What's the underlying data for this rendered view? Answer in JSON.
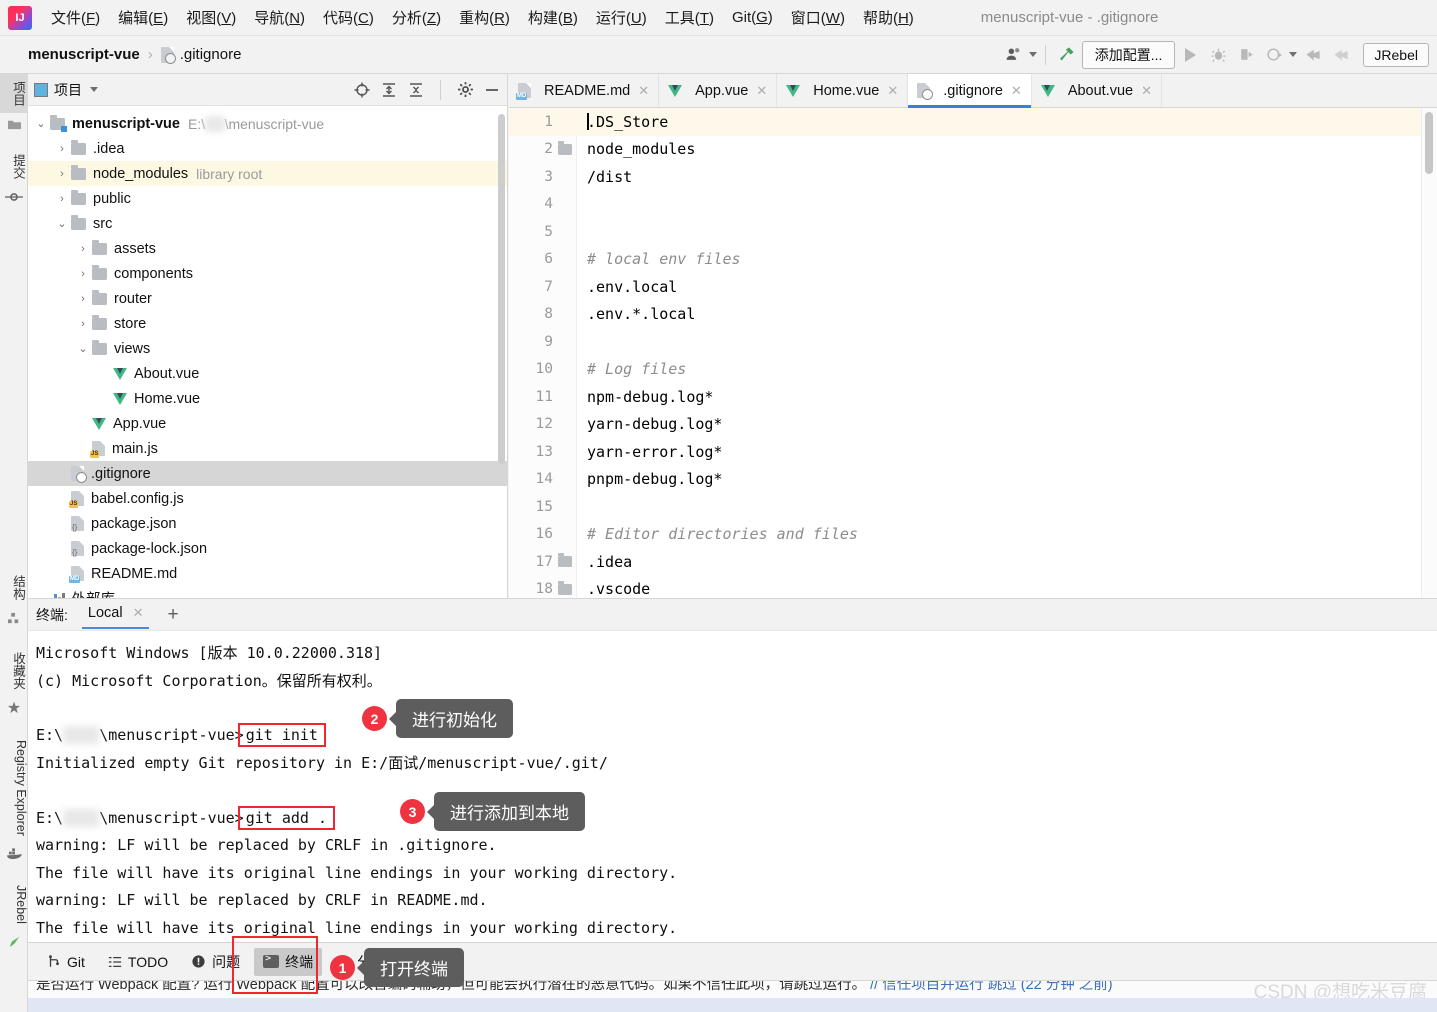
{
  "window": {
    "title": "menuscript-vue - .gitignore"
  },
  "menubar": [
    {
      "label": "文件",
      "mnemonic": "F"
    },
    {
      "label": "编辑",
      "mnemonic": "E"
    },
    {
      "label": "视图",
      "mnemonic": "V"
    },
    {
      "label": "导航",
      "mnemonic": "N"
    },
    {
      "label": "代码",
      "mnemonic": "C"
    },
    {
      "label": "分析",
      "mnemonic": "Z"
    },
    {
      "label": "重构",
      "mnemonic": "R"
    },
    {
      "label": "构建",
      "mnemonic": "B"
    },
    {
      "label": "运行",
      "mnemonic": "U"
    },
    {
      "label": "工具",
      "mnemonic": "T"
    },
    {
      "label": "Git",
      "mnemonic": "G"
    },
    {
      "label": "窗口",
      "mnemonic": "W"
    },
    {
      "label": "帮助",
      "mnemonic": "H"
    }
  ],
  "navbar": {
    "breadcrumb_project": "menuscript-vue",
    "breadcrumb_sep": "›",
    "breadcrumb_file": ".gitignore",
    "add_config_label": "添加配置...",
    "jrebel_label": "JRebel"
  },
  "left_strip": [
    {
      "label": "项目",
      "icon": "project-icon",
      "active": true
    },
    {
      "label": "提交",
      "icon": "commit-icon",
      "active": false
    },
    {
      "label": "结构",
      "icon": "structure-icon",
      "active": false
    },
    {
      "label": "收藏夹",
      "icon": "star-icon",
      "active": false
    },
    {
      "label": "Registry Explorer",
      "icon": "docker-icon",
      "active": false
    },
    {
      "label": "JRebel",
      "icon": "jrebel-icon",
      "active": false
    }
  ],
  "project_panel": {
    "title": "项目",
    "tree": [
      {
        "depth": 0,
        "arrow": "⌄",
        "icon": "folder-module",
        "label": "menuscript-vue",
        "bold": true,
        "dim": "E:\\",
        "dim_blur": true,
        "dim_tail": "\\menuscript-vue",
        "state": "normal"
      },
      {
        "depth": 1,
        "arrow": "›",
        "icon": "folder",
        "label": ".idea",
        "state": "normal"
      },
      {
        "depth": 1,
        "arrow": "›",
        "icon": "folder",
        "label": "node_modules",
        "dim": "library root",
        "state": "highlight"
      },
      {
        "depth": 1,
        "arrow": "›",
        "icon": "folder",
        "label": "public",
        "state": "normal"
      },
      {
        "depth": 1,
        "arrow": "⌄",
        "icon": "folder",
        "label": "src",
        "state": "normal"
      },
      {
        "depth": 2,
        "arrow": "›",
        "icon": "folder",
        "label": "assets",
        "state": "normal"
      },
      {
        "depth": 2,
        "arrow": "›",
        "icon": "folder",
        "label": "components",
        "state": "normal"
      },
      {
        "depth": 2,
        "arrow": "›",
        "icon": "folder",
        "label": "router",
        "state": "normal"
      },
      {
        "depth": 2,
        "arrow": "›",
        "icon": "folder",
        "label": "store",
        "state": "normal"
      },
      {
        "depth": 2,
        "arrow": "⌄",
        "icon": "folder",
        "label": "views",
        "state": "normal"
      },
      {
        "depth": 3,
        "arrow": "",
        "icon": "vue",
        "label": "About.vue",
        "state": "normal"
      },
      {
        "depth": 3,
        "arrow": "",
        "icon": "vue",
        "label": "Home.vue",
        "state": "normal"
      },
      {
        "depth": 2,
        "arrow": "",
        "icon": "vue",
        "label": "App.vue",
        "state": "normal"
      },
      {
        "depth": 2,
        "arrow": "",
        "icon": "js",
        "label": "main.js",
        "state": "normal"
      },
      {
        "depth": 1,
        "arrow": "",
        "icon": "gitignore",
        "label": ".gitignore",
        "state": "selected"
      },
      {
        "depth": 1,
        "arrow": "",
        "icon": "js",
        "label": "babel.config.js",
        "state": "normal"
      },
      {
        "depth": 1,
        "arrow": "",
        "icon": "json",
        "label": "package.json",
        "state": "normal"
      },
      {
        "depth": 1,
        "arrow": "",
        "icon": "json",
        "label": "package-lock.json",
        "state": "normal"
      },
      {
        "depth": 1,
        "arrow": "",
        "icon": "md",
        "label": "README.md",
        "state": "normal"
      }
    ],
    "external_libraries": "外部库"
  },
  "editor": {
    "tabs": [
      {
        "label": "README.md",
        "icon": "md-file-icon",
        "active": false
      },
      {
        "label": "App.vue",
        "icon": "vue-file-icon",
        "active": false
      },
      {
        "label": "Home.vue",
        "icon": "vue-file-icon",
        "active": false
      },
      {
        "label": ".gitignore",
        "icon": "gitignore-file-icon",
        "active": true
      },
      {
        "label": "About.vue",
        "icon": "vue-file-icon",
        "active": false
      }
    ],
    "lines": [
      {
        "n": "1",
        "text": ".DS_Store",
        "comment": false,
        "fold": false,
        "current": true,
        "caret": true
      },
      {
        "n": "2",
        "text": "node_modules",
        "comment": false,
        "fold": true,
        "current": false,
        "caret": false
      },
      {
        "n": "3",
        "text": "/dist",
        "comment": false,
        "fold": false,
        "current": false,
        "caret": false
      },
      {
        "n": "4",
        "text": "",
        "comment": false,
        "fold": false,
        "current": false,
        "caret": false
      },
      {
        "n": "5",
        "text": "",
        "comment": false,
        "fold": false,
        "current": false,
        "caret": false
      },
      {
        "n": "6",
        "text": "# local env files",
        "comment": true,
        "fold": false,
        "current": false,
        "caret": false
      },
      {
        "n": "7",
        "text": ".env.local",
        "comment": false,
        "fold": false,
        "current": false,
        "caret": false
      },
      {
        "n": "8",
        "text": ".env.*.local",
        "comment": false,
        "fold": false,
        "current": false,
        "caret": false
      },
      {
        "n": "9",
        "text": "",
        "comment": false,
        "fold": false,
        "current": false,
        "caret": false
      },
      {
        "n": "10",
        "text": "# Log files",
        "comment": true,
        "fold": false,
        "current": false,
        "caret": false
      },
      {
        "n": "11",
        "text": "npm-debug.log*",
        "comment": false,
        "fold": false,
        "current": false,
        "caret": false
      },
      {
        "n": "12",
        "text": "yarn-debug.log*",
        "comment": false,
        "fold": false,
        "current": false,
        "caret": false
      },
      {
        "n": "13",
        "text": "yarn-error.log*",
        "comment": false,
        "fold": false,
        "current": false,
        "caret": false
      },
      {
        "n": "14",
        "text": "pnpm-debug.log*",
        "comment": false,
        "fold": false,
        "current": false,
        "caret": false
      },
      {
        "n": "15",
        "text": "",
        "comment": false,
        "fold": false,
        "current": false,
        "caret": false
      },
      {
        "n": "16",
        "text": "# Editor directories and files",
        "comment": true,
        "fold": false,
        "current": false,
        "caret": false
      },
      {
        "n": "17",
        "text": ".idea",
        "comment": false,
        "fold": true,
        "current": false,
        "caret": false
      },
      {
        "n": "18",
        "text": ".vscode",
        "comment": false,
        "fold": true,
        "current": false,
        "caret": false
      }
    ]
  },
  "terminal": {
    "label": "终端:",
    "tab": "Local",
    "lines": [
      {
        "type": "plain",
        "text": "Microsoft Windows [版本 10.0.22000.318]"
      },
      {
        "type": "plain",
        "text": "(c) Microsoft Corporation。保留所有权利。"
      },
      {
        "type": "blank",
        "text": ""
      },
      {
        "type": "prompt",
        "prefix": "E:\\",
        "blur": true,
        "prefix_tail": "\\menuscript-vue>",
        "command": "git init"
      },
      {
        "type": "plain",
        "text": "Initialized empty Git repository in E:/面试/menuscript-vue/.git/"
      },
      {
        "type": "blank",
        "text": ""
      },
      {
        "type": "prompt",
        "prefix": "E:\\",
        "blur": true,
        "prefix_tail": "\\menuscript-vue>",
        "command": "git add ."
      },
      {
        "type": "plain",
        "text": "warning: LF will be replaced by CRLF in .gitignore."
      },
      {
        "type": "plain",
        "text": "The file will have its original line endings in your working directory."
      },
      {
        "type": "plain",
        "text": "warning: LF will be replaced by CRLF in README.md."
      },
      {
        "type": "plain",
        "text": "The file will have its original line endings in your working directory."
      }
    ]
  },
  "callouts": [
    {
      "num": "1",
      "text": "打开终端"
    },
    {
      "num": "2",
      "text": "进行初始化"
    },
    {
      "num": "3",
      "text": "进行添加到本地"
    }
  ],
  "statusbar": [
    {
      "label": "Git",
      "icon": "git-branch-icon",
      "active": false
    },
    {
      "label": "TODO",
      "icon": "todo-list-icon",
      "active": false
    },
    {
      "label": "问题",
      "icon": "problems-icon",
      "active": false
    },
    {
      "label": "终端",
      "icon": "terminal-icon",
      "active": true
    },
    {
      "label": "分析器",
      "icon": "profiler-icon",
      "active": false
    }
  ],
  "notification": {
    "text": "是否运行 Webpack 配置? 运行 Webpack 配置可以改善编码辅助，但可能会执行潜在的恶意代码。如果不信任此项，请跳过运行。",
    "actions": "// 信任项目并运行  跳过 (22 分钟 之前)",
    "watermark": "CSDN @想吃米豆腐"
  },
  "colors": {
    "accent_blue": "#3c7fd0",
    "callout_red": "#ef3340",
    "vue_green": "#41b883",
    "highlight_yellow": "#fdf8e2"
  }
}
